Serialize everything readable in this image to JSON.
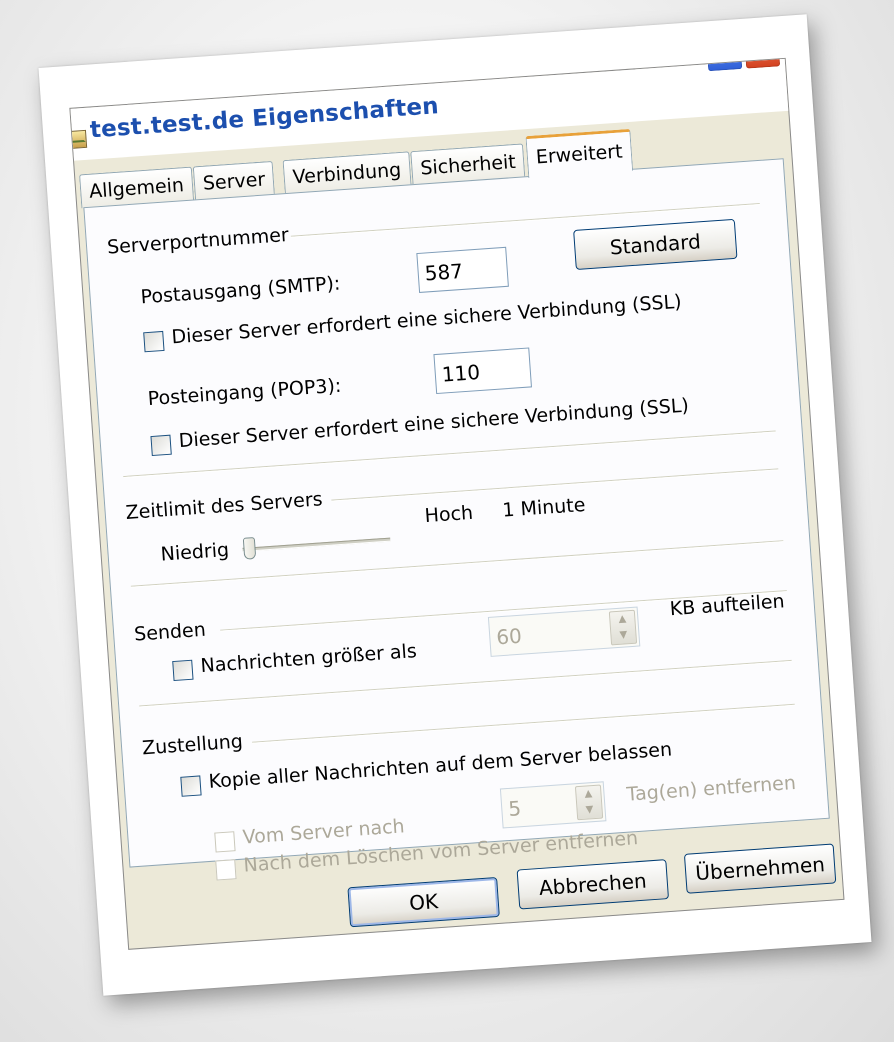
{
  "window": {
    "title": "test.test.de Eigenschaften",
    "help_label": "?",
    "close_label": "X"
  },
  "tabs": [
    {
      "label": "Allgemein",
      "active": false
    },
    {
      "label": "Server",
      "active": false
    },
    {
      "label": "Verbindung",
      "active": false
    },
    {
      "label": "Sicherheit",
      "active": false
    },
    {
      "label": "Erweitert",
      "active": true
    }
  ],
  "serverports": {
    "group_label": "Serverportnummer",
    "smtp_label": "Postausgang (SMTP):",
    "smtp_value": "587",
    "standard_button": "Standard",
    "smtp_ssl_label": "Dieser Server erfordert eine sichere Verbindung (SSL)",
    "pop3_label": "Posteingang (POP3):",
    "pop3_value": "110",
    "pop3_ssl_label": "Dieser Server erfordert eine sichere Verbindung (SSL)"
  },
  "timeout": {
    "group_label": "Zeitlimit des Servers",
    "low_label": "Niedrig",
    "high_label": "Hoch",
    "value_label": "1 Minute",
    "slider_level": 0.05
  },
  "send": {
    "group_label": "Senden",
    "split_label": "Nachrichten größer als",
    "split_value": "60",
    "split_unit": "KB aufteilen"
  },
  "delivery": {
    "group_label": "Zustellung",
    "keep_copy_label": "Kopie aller Nachrichten auf dem Server belassen",
    "remove_after_label": "Vom Server nach",
    "remove_after_value": "5",
    "remove_after_unit": "Tag(en) entfernen",
    "remove_on_delete_label": "Nach dem Löschen vom Server entfernen"
  },
  "buttons": {
    "ok": "OK",
    "cancel": "Abbrechen",
    "apply": "Übernehmen"
  }
}
